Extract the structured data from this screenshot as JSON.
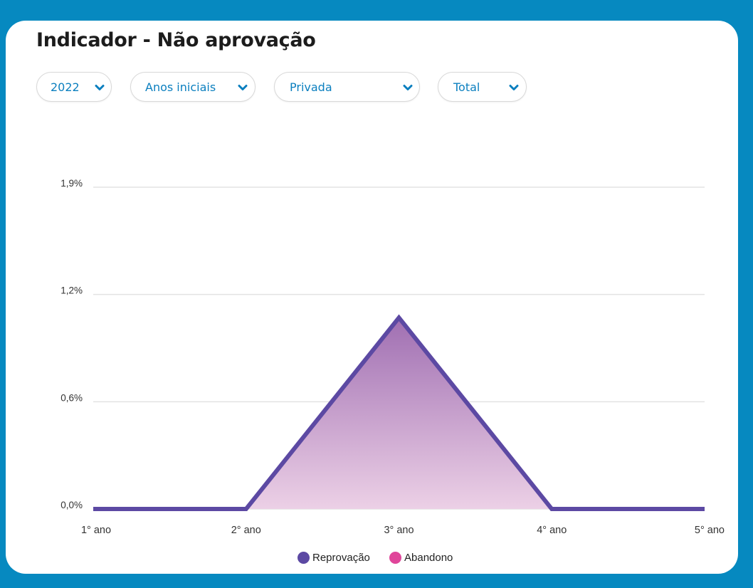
{
  "title": "Indicador - Não aprovação",
  "filters": [
    {
      "label": "2022"
    },
    {
      "label": "Anos iniciais"
    },
    {
      "label": "Privada"
    },
    {
      "label": "Total"
    }
  ],
  "colors": {
    "frame": "#0689c0",
    "filter_text": "#0b7fbf",
    "series_line": "#5c49a3",
    "area_top": "#a06fb2",
    "area_bottom": "#ecd0e6",
    "abandono": "#e0459a",
    "gridline": "#e3e3e3"
  },
  "chart_data": {
    "type": "area",
    "categories": [
      "1° ano",
      "2° ano",
      "3° ano",
      "4° ano",
      "5° ano"
    ],
    "y_tick_labels": [
      "0,0%",
      "0,6%",
      "1,2%",
      "1,9%"
    ],
    "y_tick_values": [
      0.0,
      0.6,
      1.2,
      1.8
    ],
    "ylim": [
      0.0,
      1.8
    ],
    "grid": true,
    "legend_position": "bottom-center",
    "series": [
      {
        "name": "Reprovação",
        "values": [
          0.0,
          0.0,
          1.07,
          0.0,
          0.0
        ],
        "color": "#5c49a3"
      },
      {
        "name": "Abandono",
        "values": [],
        "color": "#e0459a"
      }
    ]
  }
}
